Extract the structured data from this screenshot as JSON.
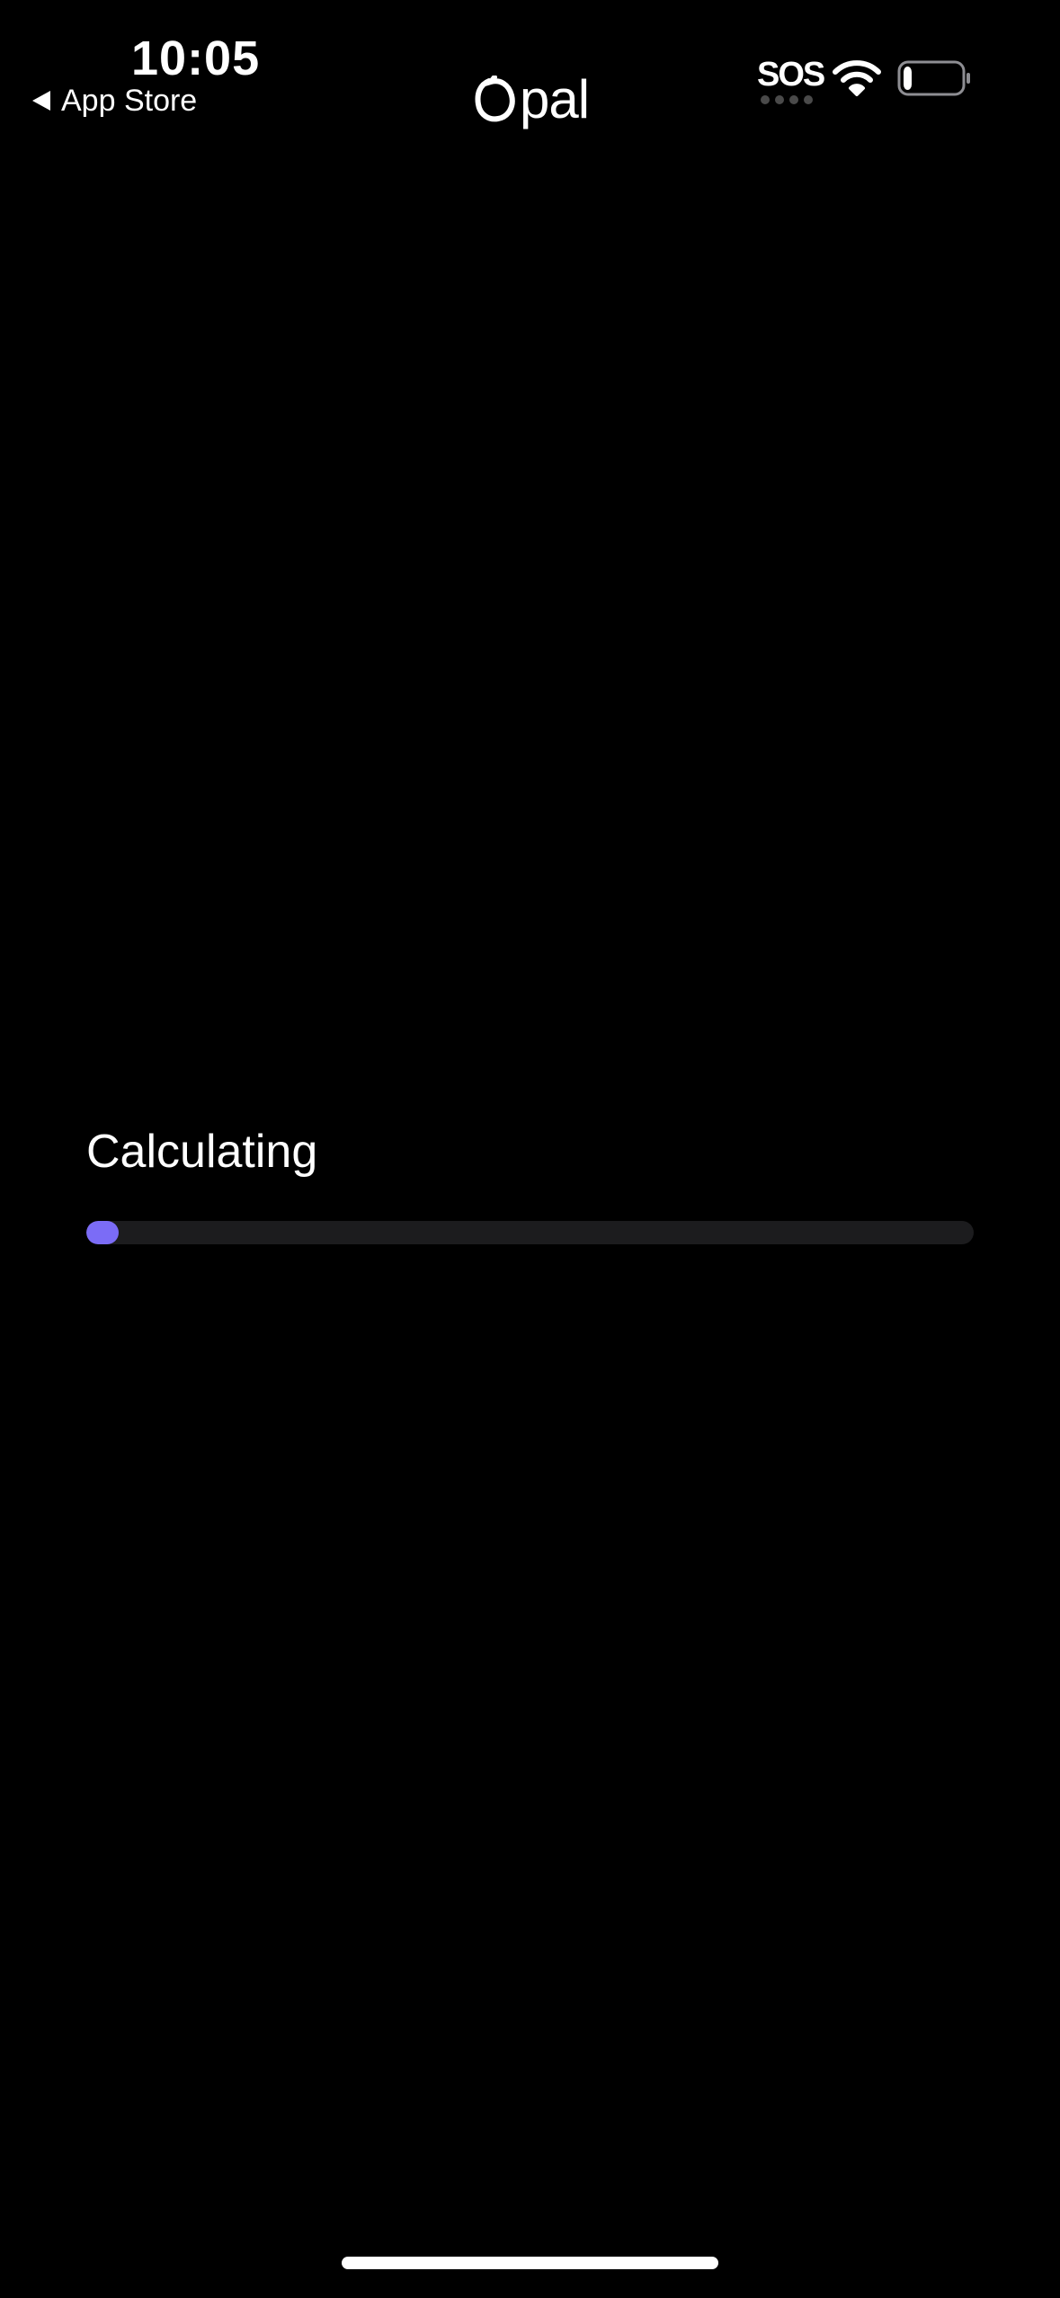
{
  "status_bar": {
    "time": "10:05",
    "back_label": "App Store",
    "sos_label": "SOS",
    "battery_level": 0.15
  },
  "header": {
    "logo_text": "pal"
  },
  "main": {
    "title": "Calculating",
    "progress": 0.035
  },
  "colors": {
    "background": "#000000",
    "progress_track": "#1c1c1e",
    "progress_accent": "#7b6cf6"
  }
}
